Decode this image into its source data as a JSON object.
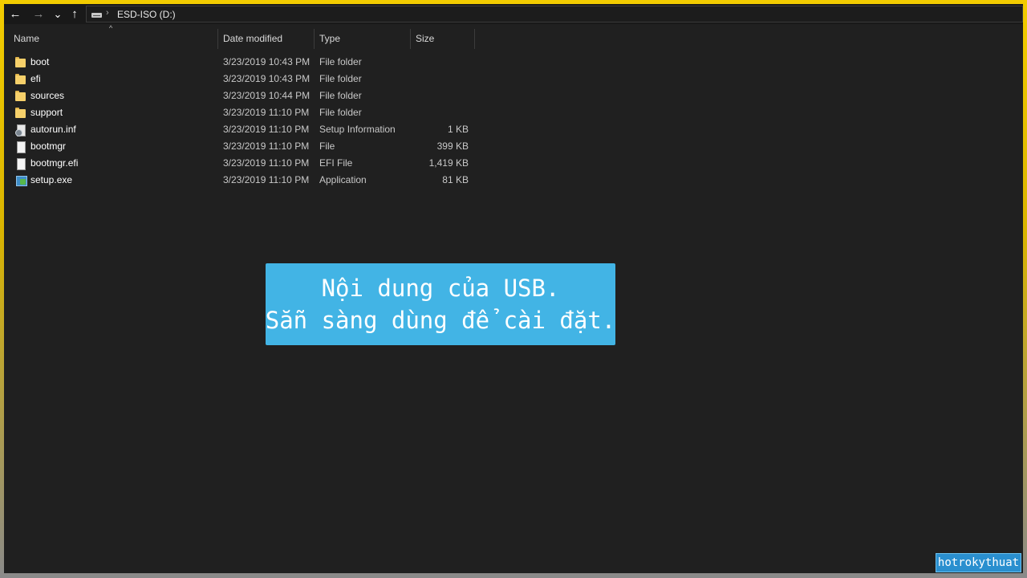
{
  "toolbar": {
    "back_icon": "←",
    "forward_icon": "→",
    "recent_icon": "⌄",
    "up_icon": "↑",
    "separator": "›",
    "location": "ESD-ISO (D:)"
  },
  "columns": {
    "name": "Name",
    "date": "Date modified",
    "type": "Type",
    "size": "Size",
    "sort_indicator": "^"
  },
  "files": [
    {
      "name": "boot",
      "date": "3/23/2019 10:43 PM",
      "type": "File folder",
      "size": "",
      "icon": "folder-icon"
    },
    {
      "name": "efi",
      "date": "3/23/2019 10:43 PM",
      "type": "File folder",
      "size": "",
      "icon": "folder-icon"
    },
    {
      "name": "sources",
      "date": "3/23/2019 10:44 PM",
      "type": "File folder",
      "size": "",
      "icon": "folder-icon"
    },
    {
      "name": "support",
      "date": "3/23/2019 11:10 PM",
      "type": "File folder",
      "size": "",
      "icon": "folder-icon"
    },
    {
      "name": "autorun.inf",
      "date": "3/23/2019 11:10 PM",
      "type": "Setup Information",
      "size": "1 KB",
      "icon": "setup-info-file-icon"
    },
    {
      "name": "bootmgr",
      "date": "3/23/2019 11:10 PM",
      "type": "File",
      "size": "399 KB",
      "icon": "file-icon"
    },
    {
      "name": "bootmgr.efi",
      "date": "3/23/2019 11:10 PM",
      "type": "EFI File",
      "size": "1,419 KB",
      "icon": "file-icon"
    },
    {
      "name": "setup.exe",
      "date": "3/23/2019 11:10 PM",
      "type": "Application",
      "size": "81 KB",
      "icon": "application-icon"
    }
  ],
  "banner": {
    "line1": "Nội dung của USB.",
    "line2": "Sẵn sàng dùng để cài đặt."
  },
  "watermark": "hotrokythuat",
  "colors": {
    "frame": "#f2cc00",
    "background": "#202020",
    "banner": "#42b4e5",
    "watermark": "#2a8fcf"
  }
}
